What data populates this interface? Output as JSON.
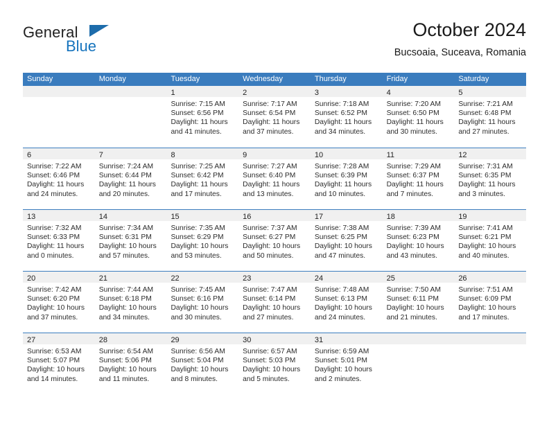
{
  "brand": {
    "name_top": "General",
    "name_bottom": "Blue",
    "accent_color": "#1573bd",
    "triangle_color": "#1d6cab"
  },
  "header": {
    "title": "October 2024",
    "subtitle": "Bucsoaia, Suceava, Romania"
  },
  "theme": {
    "header_row_color": "#3a7cbe",
    "daynum_band_color": "#f0f0f0",
    "text_color": "#2b2b2b"
  },
  "calendar": {
    "weekday_headers": [
      "Sunday",
      "Monday",
      "Tuesday",
      "Wednesday",
      "Thursday",
      "Friday",
      "Saturday"
    ],
    "weeks": [
      [
        {
          "day": "",
          "info": ""
        },
        {
          "day": "",
          "info": ""
        },
        {
          "day": "1",
          "info": "Sunrise: 7:15 AM\nSunset: 6:56 PM\nDaylight: 11 hours and 41 minutes."
        },
        {
          "day": "2",
          "info": "Sunrise: 7:17 AM\nSunset: 6:54 PM\nDaylight: 11 hours and 37 minutes."
        },
        {
          "day": "3",
          "info": "Sunrise: 7:18 AM\nSunset: 6:52 PM\nDaylight: 11 hours and 34 minutes."
        },
        {
          "day": "4",
          "info": "Sunrise: 7:20 AM\nSunset: 6:50 PM\nDaylight: 11 hours and 30 minutes."
        },
        {
          "day": "5",
          "info": "Sunrise: 7:21 AM\nSunset: 6:48 PM\nDaylight: 11 hours and 27 minutes."
        }
      ],
      [
        {
          "day": "6",
          "info": "Sunrise: 7:22 AM\nSunset: 6:46 PM\nDaylight: 11 hours and 24 minutes."
        },
        {
          "day": "7",
          "info": "Sunrise: 7:24 AM\nSunset: 6:44 PM\nDaylight: 11 hours and 20 minutes."
        },
        {
          "day": "8",
          "info": "Sunrise: 7:25 AM\nSunset: 6:42 PM\nDaylight: 11 hours and 17 minutes."
        },
        {
          "day": "9",
          "info": "Sunrise: 7:27 AM\nSunset: 6:40 PM\nDaylight: 11 hours and 13 minutes."
        },
        {
          "day": "10",
          "info": "Sunrise: 7:28 AM\nSunset: 6:39 PM\nDaylight: 11 hours and 10 minutes."
        },
        {
          "day": "11",
          "info": "Sunrise: 7:29 AM\nSunset: 6:37 PM\nDaylight: 11 hours and 7 minutes."
        },
        {
          "day": "12",
          "info": "Sunrise: 7:31 AM\nSunset: 6:35 PM\nDaylight: 11 hours and 3 minutes."
        }
      ],
      [
        {
          "day": "13",
          "info": "Sunrise: 7:32 AM\nSunset: 6:33 PM\nDaylight: 11 hours and 0 minutes."
        },
        {
          "day": "14",
          "info": "Sunrise: 7:34 AM\nSunset: 6:31 PM\nDaylight: 10 hours and 57 minutes."
        },
        {
          "day": "15",
          "info": "Sunrise: 7:35 AM\nSunset: 6:29 PM\nDaylight: 10 hours and 53 minutes."
        },
        {
          "day": "16",
          "info": "Sunrise: 7:37 AM\nSunset: 6:27 PM\nDaylight: 10 hours and 50 minutes."
        },
        {
          "day": "17",
          "info": "Sunrise: 7:38 AM\nSunset: 6:25 PM\nDaylight: 10 hours and 47 minutes."
        },
        {
          "day": "18",
          "info": "Sunrise: 7:39 AM\nSunset: 6:23 PM\nDaylight: 10 hours and 43 minutes."
        },
        {
          "day": "19",
          "info": "Sunrise: 7:41 AM\nSunset: 6:21 PM\nDaylight: 10 hours and 40 minutes."
        }
      ],
      [
        {
          "day": "20",
          "info": "Sunrise: 7:42 AM\nSunset: 6:20 PM\nDaylight: 10 hours and 37 minutes."
        },
        {
          "day": "21",
          "info": "Sunrise: 7:44 AM\nSunset: 6:18 PM\nDaylight: 10 hours and 34 minutes."
        },
        {
          "day": "22",
          "info": "Sunrise: 7:45 AM\nSunset: 6:16 PM\nDaylight: 10 hours and 30 minutes."
        },
        {
          "day": "23",
          "info": "Sunrise: 7:47 AM\nSunset: 6:14 PM\nDaylight: 10 hours and 27 minutes."
        },
        {
          "day": "24",
          "info": "Sunrise: 7:48 AM\nSunset: 6:13 PM\nDaylight: 10 hours and 24 minutes."
        },
        {
          "day": "25",
          "info": "Sunrise: 7:50 AM\nSunset: 6:11 PM\nDaylight: 10 hours and 21 minutes."
        },
        {
          "day": "26",
          "info": "Sunrise: 7:51 AM\nSunset: 6:09 PM\nDaylight: 10 hours and 17 minutes."
        }
      ],
      [
        {
          "day": "27",
          "info": "Sunrise: 6:53 AM\nSunset: 5:07 PM\nDaylight: 10 hours and 14 minutes."
        },
        {
          "day": "28",
          "info": "Sunrise: 6:54 AM\nSunset: 5:06 PM\nDaylight: 10 hours and 11 minutes."
        },
        {
          "day": "29",
          "info": "Sunrise: 6:56 AM\nSunset: 5:04 PM\nDaylight: 10 hours and 8 minutes."
        },
        {
          "day": "30",
          "info": "Sunrise: 6:57 AM\nSunset: 5:03 PM\nDaylight: 10 hours and 5 minutes."
        },
        {
          "day": "31",
          "info": "Sunrise: 6:59 AM\nSunset: 5:01 PM\nDaylight: 10 hours and 2 minutes."
        },
        {
          "day": "",
          "info": ""
        },
        {
          "day": "",
          "info": ""
        }
      ]
    ]
  }
}
